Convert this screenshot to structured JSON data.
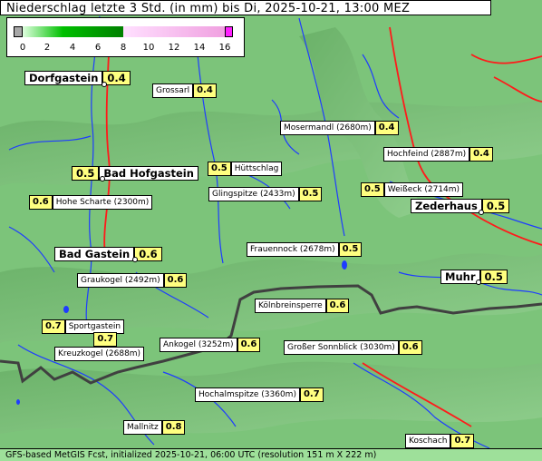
{
  "title": "Niederschlag letzte 3 Std. (in mm) bis Di, 2025-10-21, 13:00 MEZ",
  "legend": {
    "ticks": [
      "0",
      "2",
      "4",
      "6",
      "8",
      "10",
      "12",
      "14",
      "16"
    ],
    "colors": {
      "below": "#a8a8a8",
      "band_0_8": "#00c000",
      "band_8_16": "#f0a0e0",
      "above": "#ff20ff"
    }
  },
  "colors": {
    "terrain": "#7cc47a",
    "rivers": "#1e3cff",
    "roads": "#ff1a1a",
    "border": "#404040",
    "value_box": "#ffff80"
  },
  "stations": [
    {
      "name": "Dorfgastein",
      "value": "0.4",
      "kind": "town"
    },
    {
      "name": "Grossarl",
      "value": "0.4",
      "kind": "place"
    },
    {
      "name": "Mosermandl (2680m)",
      "value": "0.4",
      "kind": "peak"
    },
    {
      "name": "Hochfeind (2887m)",
      "value": "0.4",
      "kind": "peak"
    },
    {
      "name": "Bad Hofgastein",
      "value": "0.5",
      "kind": "town"
    },
    {
      "name": "Hüttschlag",
      "value": "0.5",
      "kind": "place"
    },
    {
      "name": "Glingspitze (2433m)",
      "value": "0.5",
      "kind": "peak"
    },
    {
      "name": "Weißeck (2714m)",
      "value": "0.5",
      "kind": "peak"
    },
    {
      "name": "Zederhaus",
      "value": "0.5",
      "kind": "town"
    },
    {
      "name": "Hohe Scharte (2300m)",
      "value": "0.6",
      "kind": "peak"
    },
    {
      "name": "Bad Gastein",
      "value": "0.6",
      "kind": "town"
    },
    {
      "name": "Frauennock (2678m)",
      "value": "0.5",
      "kind": "peak"
    },
    {
      "name": "Graukogel (2492m)",
      "value": "0.6",
      "kind": "peak"
    },
    {
      "name": "Muhr",
      "value": "0.5",
      "kind": "town"
    },
    {
      "name": "Kölnbreinsperre",
      "value": "0.6",
      "kind": "place"
    },
    {
      "name": "Sportgastein",
      "value": "0.7",
      "kind": "place"
    },
    {
      "name": "Kreuzkogel (2688m)",
      "value": "0.7",
      "kind": "peak"
    },
    {
      "name": "Ankogel (3252m)",
      "value": "0.6",
      "kind": "peak"
    },
    {
      "name": "Großer Sonnblick (3030m)",
      "value": "0.6",
      "kind": "peak"
    },
    {
      "name": "Hochalmspitze (3360m)",
      "value": "0.7",
      "kind": "peak"
    },
    {
      "name": "Mallnitz",
      "value": "0.8",
      "kind": "place"
    },
    {
      "name": "Koschach",
      "value": "0.7",
      "kind": "place"
    }
  ],
  "footer": "GFS-based MetGIS Fcst, initialized 2025-10-21, 06:00 UTC  (resolution 151 m X 222 m)"
}
